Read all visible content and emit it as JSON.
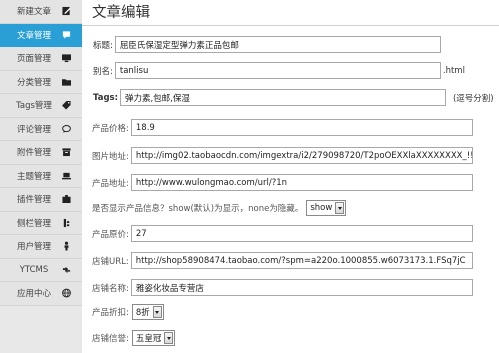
{
  "sidebar": {
    "items": [
      {
        "label": "新建文章",
        "icon": "edit-icon",
        "active": false
      },
      {
        "label": "文章管理",
        "icon": "comment-icon",
        "active": true
      },
      {
        "label": "页面管理",
        "icon": "monitor-icon",
        "active": false
      },
      {
        "label": "分类管理",
        "icon": "folder-icon",
        "active": false
      },
      {
        "label": "Tags管理",
        "icon": "tag-icon",
        "active": false
      },
      {
        "label": "评论管理",
        "icon": "speech-bubble-icon",
        "active": false
      },
      {
        "label": "附件管理",
        "icon": "archive-icon",
        "active": false
      },
      {
        "label": "主题管理",
        "icon": "laptop-icon",
        "active": false
      },
      {
        "label": "插件管理",
        "icon": "puzzle-icon",
        "active": false
      },
      {
        "label": "侧栏管理",
        "icon": "sidebar-icon",
        "active": false
      },
      {
        "label": "用户管理",
        "icon": "user-icon",
        "active": false
      },
      {
        "label": "YTCMS",
        "icon": "link-icon",
        "active": false
      },
      {
        "label": "应用中心",
        "icon": "globe-icon",
        "active": false
      }
    ]
  },
  "main": {
    "page_title": "文章编辑",
    "title": {
      "label": "标题:",
      "value": "屈臣氏保湿定型弹力素正品包邮"
    },
    "alias": {
      "label": "别名:",
      "value": "tanlisu",
      "suffix": ".html"
    },
    "tags": {
      "label": "Tags:",
      "value": "弹力素,包邮,保湿",
      "hint": "(逗号分割)"
    },
    "price": {
      "label": "产品价格:",
      "value": "18.9"
    },
    "image": {
      "label": "图片地址:",
      "value": "http://img02.taobaocdn.com/imgextra/i2/279098720/T2poOEXXlaXXXXXXXX_!!279"
    },
    "product_url": {
      "label": "产品地址:",
      "value": "http://www.wulongmao.com/url/?1n"
    },
    "show_info": {
      "label": "是否显示产品信息？show(默认)为显示，none为隐藏。",
      "selected": "show"
    },
    "orig_price": {
      "label": "产品原价:",
      "value": "27"
    },
    "shop_url": {
      "label": "店铺URL:",
      "value": "http://shop58908474.taobao.com/?spm=a220o.1000855.w6073173.1.FSq7jC"
    },
    "shop_name": {
      "label": "店铺名称:",
      "value": "雅姿化妆品专营店"
    },
    "discount": {
      "label": "产品折扣:",
      "selected": "8折"
    },
    "credit": {
      "label": "店铺信誉:",
      "selected": "五皇冠"
    }
  },
  "colors": {
    "active": "#2a9fd6",
    "sidebar_bg": "#e4e4e4"
  }
}
